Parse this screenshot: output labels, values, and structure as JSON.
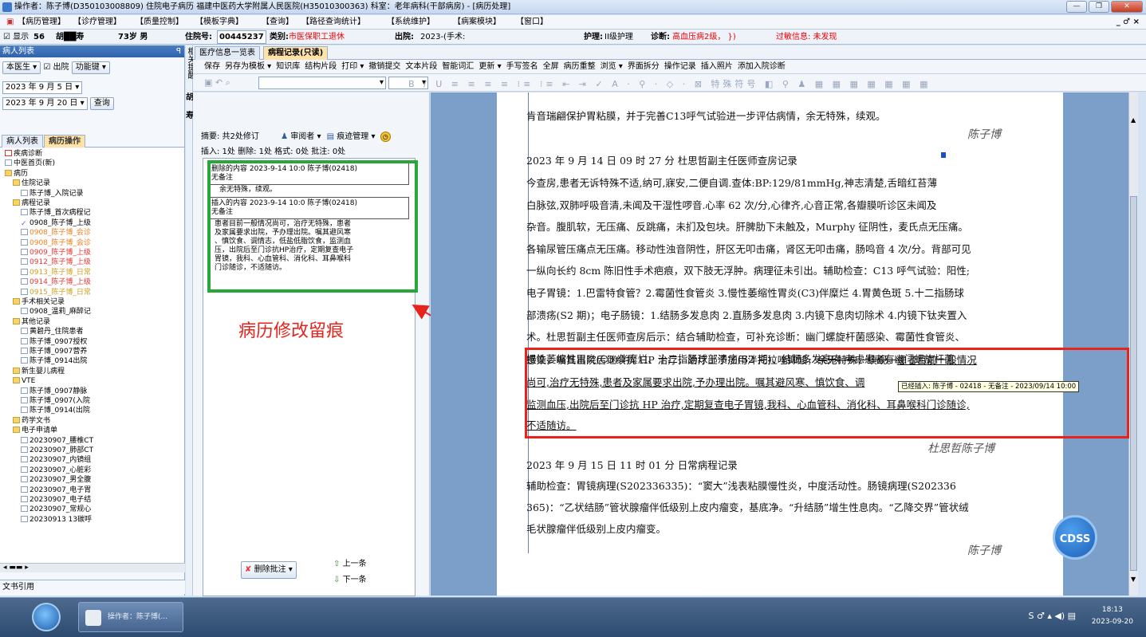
{
  "window": {
    "title": "操作者：陈子博(D350103008809) 住院电子病历  福建中医药大学附属人民医院(H35010300363)  科室：老年病科(干部病房) - [病历处理]",
    "buttons": [
      "—",
      "❐",
      "✕"
    ]
  },
  "menu": {
    "items": [
      "【病历管理】",
      "【诊疗管理】",
      "【质量控制】",
      "【模板字典】",
      "【查询】",
      "【路径查询统计】",
      "【系统维护】",
      "【病案模块】",
      "【窗口】"
    ],
    "right": "_ ♂ ×"
  },
  "patient": {
    "show_label": "显示",
    "bed": "56",
    "name": "胡██寿",
    "age_sex": "73岁 男",
    "admission_label": "住院号:",
    "admission_no": "00445237",
    "category_label": "类别:",
    "category": "市医保职工退休",
    "discharge_label": "出院:",
    "discharge": "2023-(手术:",
    "nursing_label": "护理:",
    "nursing": "II级护理",
    "diagnosis_label": "诊断:",
    "diagnosis": "高血压病2级，  })",
    "allergy": "过敏信息: 未发现"
  },
  "left": {
    "panel_title": "病人列表",
    "pin": "ꟼ",
    "doctor_select": "本医生",
    "discharged_label": "出院",
    "func_label": "功能键",
    "date_from": "2023 年 9 月 5 日",
    "date_to": "2023 年 9 月 20 日",
    "query_label": "查询",
    "tabs": [
      "病人列表",
      "病历操作"
    ],
    "tree": [
      {
        "label": "疾病诊断",
        "ico": "redbox",
        "indent": 0,
        "color": ""
      },
      {
        "label": "中医首页(新)",
        "ico": "doc",
        "indent": 0,
        "color": ""
      },
      {
        "label": "病历",
        "ico": "folder",
        "indent": 0,
        "color": ""
      },
      {
        "label": "住院记录",
        "ico": "folder",
        "indent": 1,
        "color": ""
      },
      {
        "label": "陈子博_入院记录",
        "ico": "doc",
        "indent": 2,
        "color": ""
      },
      {
        "label": "病程记录",
        "ico": "folder",
        "indent": 1,
        "color": ""
      },
      {
        "label": "陈子博_首次病程记",
        "ico": "doc",
        "indent": 2,
        "color": ""
      },
      {
        "label": "0908_陈子博_上级",
        "ico": "check",
        "indent": 2,
        "color": ""
      },
      {
        "label": "0908_陈子博_会诊",
        "ico": "doc",
        "indent": 2,
        "color": "orange"
      },
      {
        "label": "0908_陈子博_会诊",
        "ico": "doc",
        "indent": 2,
        "color": "orange"
      },
      {
        "label": "0909_陈子博_上级",
        "ico": "doc",
        "indent": 2,
        "color": "red"
      },
      {
        "label": "0912_陈子博_上级",
        "ico": "doc",
        "indent": 2,
        "color": "red"
      },
      {
        "label": "0913_陈子博_日常",
        "ico": "doc",
        "indent": 2,
        "color": "gold"
      },
      {
        "label": "0914_陈子博_上级",
        "ico": "doc",
        "indent": 2,
        "color": "red"
      },
      {
        "label": "0915_陈子博_日常",
        "ico": "doc",
        "indent": 2,
        "color": "gold"
      },
      {
        "label": "手术相关记录",
        "ico": "folder",
        "indent": 1,
        "color": ""
      },
      {
        "label": "0908_温莉_麻醉记",
        "ico": "doc",
        "indent": 2,
        "color": ""
      },
      {
        "label": "其他记录",
        "ico": "folder",
        "indent": 1,
        "color": ""
      },
      {
        "label": "黄碧丹_住院患者",
        "ico": "doc",
        "indent": 2,
        "color": ""
      },
      {
        "label": "陈子博_0907授权",
        "ico": "doc",
        "indent": 2,
        "color": ""
      },
      {
        "label": "陈子博_0907营养",
        "ico": "doc",
        "indent": 2,
        "color": ""
      },
      {
        "label": "陈子博_0914出院",
        "ico": "doc",
        "indent": 2,
        "color": ""
      },
      {
        "label": "新生婴儿病程",
        "ico": "folder",
        "indent": 1,
        "color": ""
      },
      {
        "label": "VTE",
        "ico": "folder",
        "indent": 1,
        "color": ""
      },
      {
        "label": "陈子博_0907静脉",
        "ico": "doc",
        "indent": 2,
        "color": ""
      },
      {
        "label": "陈子博_0907(入院",
        "ico": "doc",
        "indent": 2,
        "color": ""
      },
      {
        "label": "陈子博_0914(出院",
        "ico": "doc",
        "indent": 2,
        "color": ""
      },
      {
        "label": "药学文书",
        "ico": "folder",
        "indent": 1,
        "color": ""
      },
      {
        "label": "电子申请单",
        "ico": "folder",
        "indent": 1,
        "color": ""
      },
      {
        "label": "20230907_腰椎CT",
        "ico": "doc",
        "indent": 2,
        "color": ""
      },
      {
        "label": "20230907_肺部CT",
        "ico": "doc",
        "indent": 2,
        "color": ""
      },
      {
        "label": "20230907_内镜组",
        "ico": "doc",
        "indent": 2,
        "color": ""
      },
      {
        "label": "20230907_心脏彩",
        "ico": "doc",
        "indent": 2,
        "color": ""
      },
      {
        "label": "20230907_男全腹",
        "ico": "doc",
        "indent": 2,
        "color": ""
      },
      {
        "label": "20230907_电子胃",
        "ico": "doc",
        "indent": 2,
        "color": ""
      },
      {
        "label": "20230907_电子结",
        "ico": "doc",
        "indent": 2,
        "color": ""
      },
      {
        "label": "20230907_常规心",
        "ico": "doc",
        "indent": 2,
        "color": ""
      },
      {
        "label": "20230913 13碳呼",
        "ico": "doc",
        "indent": 2,
        "color": ""
      }
    ],
    "bottom": "文书引用"
  },
  "side_strip": "相关提醒",
  "side_strip2": "胡",
  "side_strip3": "寿",
  "doc_tabs": [
    "医疗信息一览表",
    "病程记录(只读)"
  ],
  "toolbar": [
    "保存",
    "另存为模板 ▾",
    "知识库",
    "结构片段",
    "打印 ▾",
    "撤销提交",
    "文本片段",
    "智能词汇",
    "更新 ▾",
    "手写签名",
    "全屏",
    "病历重整",
    "浏览 ▾",
    "界面拆分",
    "操作记录",
    "插入照片",
    "添加入院诊断"
  ],
  "toolbar2_icons": "B / U ≡ ≡ ≡ ≡ ⁝≡ ⁝≡ ⇤ ⇥ ✓ A · ⚲ · ◇ · ⊠ 特殊符号 ◧ ⚲ ♟ ▦ ▦ ▦ ▦ ▦ ▦ ▦",
  "revisions": {
    "summary": "摘要: 共2处修订",
    "reviewer": "审阅者 ▾",
    "trace_mgr": "痕迹管理 ▾",
    "stats": "插入: 1处    删除: 1处    格式: 0处    批注: 0处",
    "del_header": "删除的内容  2023-9-14 10:0    陈子博(02418)",
    "del_note": "无备注",
    "del_text": "余无特殊，续观。",
    "ins_header": "插入的内容  2023-9-14 10:0    陈子博(02418)",
    "ins_note": "无备注",
    "ins_text": [
      "患者目前一般情况尚可，治疗无特殊，患者",
      "及家属要求出院，予办理出院。嘱其避风寒",
      "、慎饮食、调情志，低盐低脂饮食，监测血",
      "压，出院后至门诊抗HP治疗，定期复查电子",
      "胃镜，我科、心血管科、消化科、耳鼻喉科",
      "门诊随诊，不适随访。"
    ],
    "delete_btn": "删除批注 ▾",
    "prev": "上一条",
    "next": "下一条"
  },
  "annotation": "病历修改留痕",
  "document": {
    "line0": "肯音瑞翩保护胃粘膜，并于完善C13呼气试验进一步评估病情，余无特殊，续观。",
    "sig1": "陈子博",
    "rec1_title": "2023 年 9 月 14 日 09 时 27 分        杜思哲副主任医师查房记录",
    "rec1_lines": [
      "    今查房,患者无诉特殊不适,纳可,寐安,二便自调.查体:BP:129/81mmHg,神志清楚,舌暗红苔薄",
      "白脉弦,双肺呼吸音清,未闻及干湿性啰音.心率 62 次/分,心律齐,心音正常,各瓣膜听诊区未闻及",
      "杂音。腹肌软，无压痛、反跳痛，未扪及包块。肝脾肋下未触及，Murphy 征阴性，麦氏点无压痛。",
      "各输尿管压痛点无压痛。移动性浊音阴性，肝区无叩击痛，肾区无叩击痛，肠鸣音 4 次/分。背部可见",
      "一纵向长约 8cm 陈旧性手术疤痕，双下肢无浮肿。病理征未引出。辅助检查：C13 呼气试验：阳性;",
      "电子胃镜：1.巴雷特食管？2.霉菌性食管炎 3.慢性萎缩性胃炎(C3)伴糜烂 4.胃黄色斑 5.十二指肠球",
      "部溃疡(S2 期)；电子肠镜：1.结肠多发息肉 2.直肠多发息肉 3.内镜下息肉切除术 4.内镜下钛夹置入",
      "术。杜思哲副主任医师查房后示：结合辅助检查，可补充诊断：幽门螺旋杆菌感染、霉菌性食管炎、",
      "慢性萎缩性胃炎(C3)伴糜烂、十二指肠球部溃疡(S2 期)、结肠多发息肉,考虑患者有幽门螺旋杆菌"
    ],
    "red_l1_a": "感染，嘱其出院后继续抗 HP 治疗，治疗上予加用泮托拉唑抑酸，",
    "red_l1_del": "余无特殊，续观。",
    "red_l1_ins": "患者目前一般情况",
    "red_l2": "尚可,治疗无特殊,患者及家属要求出院,予办理出院。嘱其避风寒、慎饮食、调",
    "red_l3": "监测血压,出院后至门诊抗 HP 治疗,定期复查电子胃镜,我科、心血管科、消化科、耳鼻喉科门诊随诊,",
    "red_l4": "不适随访。",
    "tooltip": "已经插入: 陈子博 - 02418 - 无备注 - 2023/09/14 10:00",
    "sig2": "杜思哲陈子博",
    "rec2_title": "2023 年 9 月 15 日 11 时 01 分              日常病程记录",
    "rec2_lines": [
      "    辅助检查：胃镜病理(S202336335)：“窦大”浅表粘膜慢性炎，中度活动性。肠镜病理(S202336",
      "365)：“乙状结肠”管状腺瘤伴低级别上皮内瘤变，基底净。“升结肠”增生性息肉。“乙降交界”管状绒",
      "毛状腺瘤伴低级别上皮内瘤变。"
    ],
    "sig3": "陈子博",
    "cdss": "CDSS"
  },
  "taskbar": {
    "item": "操作者：陈子博(...",
    "tray": "S ♂ ▴ ◀) ▤",
    "time": "18:13",
    "date": "2023-09-20"
  },
  "colors": {
    "annotation_red": "#e8231c",
    "highlight_green": "#2aa73a",
    "tab_active": "#ffe2a8"
  }
}
